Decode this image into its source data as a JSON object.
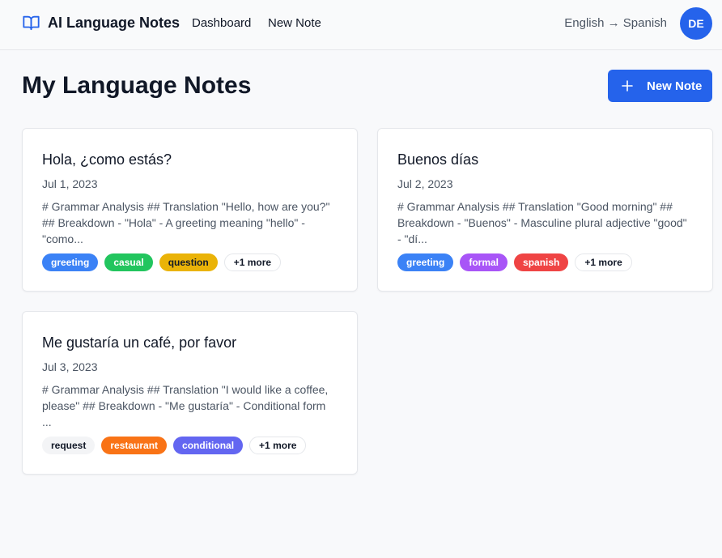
{
  "header": {
    "brand": "AI Language Notes",
    "nav": [
      {
        "label": "Dashboard"
      },
      {
        "label": "New Note"
      }
    ],
    "language_pair": "English → Spanish",
    "avatar_initials": "DE"
  },
  "main": {
    "title": "My Language Notes",
    "new_note_button": "New Note"
  },
  "notes": [
    {
      "title": "Hola, ¿como estás?",
      "date": "Jul 1, 2023",
      "excerpt": "# Grammar Analysis ## Translation \"Hello, how are you?\" ## Breakdown - \"Hola\" - A greeting meaning \"hello\" - \"como...",
      "tags": [
        {
          "label": "greeting",
          "color": "#3b82f6",
          "text_color": "#ffffff"
        },
        {
          "label": "casual",
          "color": "#22c55e",
          "text_color": "#ffffff"
        },
        {
          "label": "question",
          "color": "#eab308",
          "text_color": "#111827"
        },
        {
          "label": "+1 more",
          "color": "#ffffff",
          "text_color": "#111827"
        }
      ]
    },
    {
      "title": "Buenos días",
      "date": "Jul 2, 2023",
      "excerpt": "# Grammar Analysis ## Translation \"Good morning\" ## Breakdown - \"Buenos\" - Masculine plural adjective \"good\" - \"dí...",
      "tags": [
        {
          "label": "greeting",
          "color": "#3b82f6",
          "text_color": "#ffffff"
        },
        {
          "label": "formal",
          "color": "#a855f7",
          "text_color": "#ffffff"
        },
        {
          "label": "spanish",
          "color": "#ef4444",
          "text_color": "#ffffff"
        },
        {
          "label": "+1 more",
          "color": "#ffffff",
          "text_color": "#111827"
        }
      ]
    },
    {
      "title": "Me gustaría un café, por favor",
      "date": "Jul 3, 2023",
      "excerpt": "# Grammar Analysis ## Translation \"I would like a coffee, please\" ## Breakdown - \"Me gustaría\" - Conditional form ...",
      "tags": [
        {
          "label": "request",
          "color": "#f3f4f6",
          "text_color": "#111827"
        },
        {
          "label": "restaurant",
          "color": "#f97316",
          "text_color": "#ffffff"
        },
        {
          "label": "conditional",
          "color": "#6366f1",
          "text_color": "#ffffff"
        },
        {
          "label": "+1 more",
          "color": "#ffffff",
          "text_color": "#111827"
        }
      ]
    }
  ],
  "icons": {
    "brand": "book-open-icon",
    "new_note": "plus-icon"
  },
  "colors": {
    "primary": "#2563eb"
  }
}
